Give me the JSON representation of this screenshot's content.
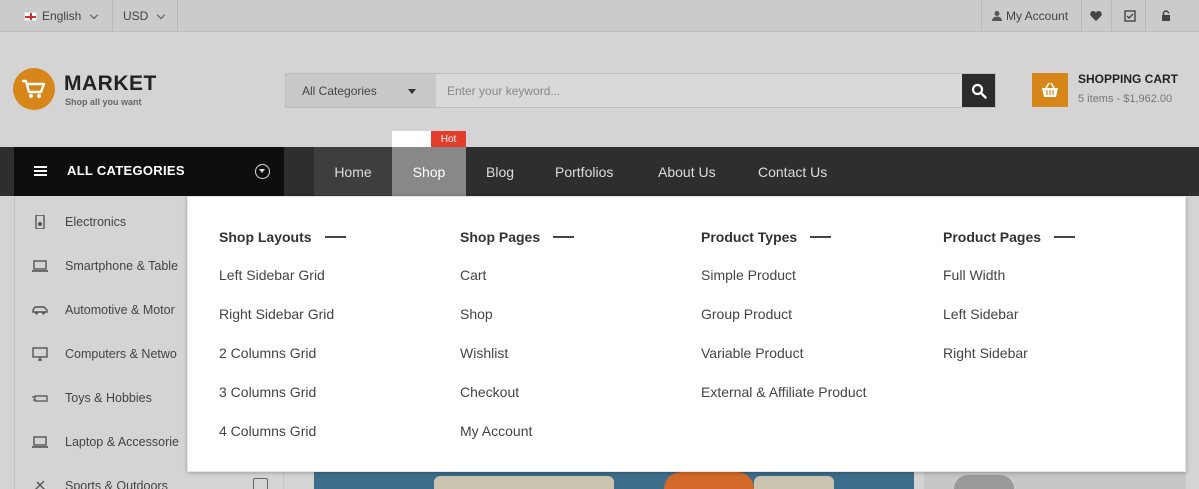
{
  "topbar": {
    "language": "English",
    "currency": "USD",
    "my_account": "My Account"
  },
  "header": {
    "logo_title": "MARKET",
    "logo_tagline": "Shop all you want",
    "search": {
      "category": "All Categories",
      "placeholder": "Enter your keyword..."
    },
    "cart": {
      "title": "SHOPPING CART",
      "summary": "5 items - $1,962.00"
    }
  },
  "nav": {
    "all_categories": "ALL CATEGORIES",
    "items": [
      "Home",
      "Shop",
      "Blog",
      "Portfolios",
      "About Us",
      "Contact Us"
    ],
    "hot_badge": "Hot"
  },
  "sidebar": {
    "items": [
      {
        "label": "Electronics",
        "icon": "electronics-icon"
      },
      {
        "label": "Smartphone & Table",
        "icon": "laptop-icon"
      },
      {
        "label": "Automotive & Motor",
        "icon": "car-icon"
      },
      {
        "label": "Computers & Netwo",
        "icon": "monitor-icon"
      },
      {
        "label": "Toys & Hobbies",
        "icon": "toy-icon"
      },
      {
        "label": "Laptop & Accessorie",
        "icon": "laptop-icon"
      },
      {
        "label": "Sports & Outdoors",
        "icon": "sports-icon"
      }
    ]
  },
  "megamenu": {
    "columns": [
      {
        "title": "Shop Layouts",
        "links": [
          "Left Sidebar Grid",
          "Right Sidebar Grid",
          "2 Columns Grid",
          "3 Columns Grid",
          "4 Columns Grid"
        ]
      },
      {
        "title": "Shop Pages",
        "links": [
          "Cart",
          "Shop",
          "Wishlist",
          "Checkout",
          "My Account"
        ]
      },
      {
        "title": "Product Types",
        "links": [
          "Simple Product",
          "Group Product",
          "Variable Product",
          "External & Affiliate Product"
        ]
      },
      {
        "title": "Product Pages",
        "links": [
          "Full Width",
          "Left Sidebar",
          "Right Sidebar"
        ]
      }
    ]
  },
  "colors": {
    "accent": "#d7861a",
    "hot": "#e53d2c",
    "nav_bg": "#2e2e2e"
  }
}
